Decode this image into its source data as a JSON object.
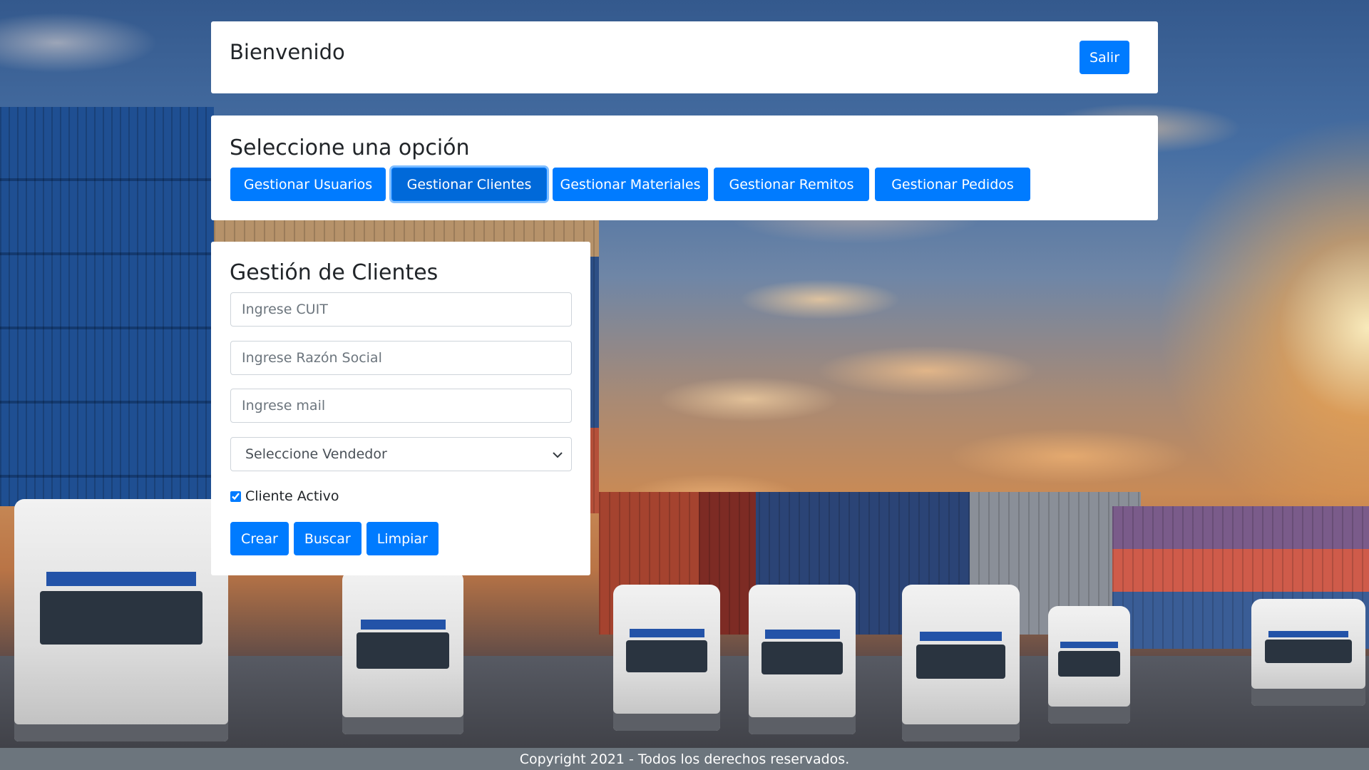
{
  "header": {
    "welcome": "Bienvenido",
    "logout_label": "Salir"
  },
  "options": {
    "title": "Seleccione una opción",
    "buttons": [
      {
        "label": "Gestionar Usuarios",
        "active": false
      },
      {
        "label": "Gestionar Clientes",
        "active": true
      },
      {
        "label": "Gestionar Materiales",
        "active": false
      },
      {
        "label": "Gestionar Remitos",
        "active": false
      },
      {
        "label": "Gestionar Pedidos",
        "active": false
      }
    ]
  },
  "form": {
    "title": "Gestión de Clientes",
    "cuit_placeholder": "Ingrese CUIT",
    "razon_social_placeholder": "Ingrese Razón Social",
    "mail_placeholder": "Ingrese mail",
    "vendedor_select": "Seleccione Vendedor",
    "activo_label": "Cliente Activo",
    "activo_checked": true,
    "buttons": {
      "create": "Crear",
      "search": "Buscar",
      "clear": "Limpiar"
    }
  },
  "footer": {
    "copyright": "Copyright 2021 - Todos los derechos reservados."
  },
  "icons": {
    "select_arrow": "chevron-down-icon"
  },
  "colors": {
    "primary": "#007bff",
    "footer_bg": "#6c757d"
  }
}
